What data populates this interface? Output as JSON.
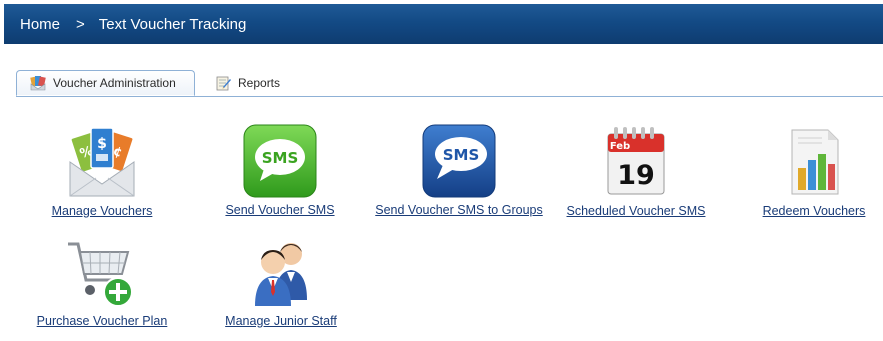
{
  "breadcrumb": {
    "home": "Home",
    "separator": ">",
    "current": "Text Voucher Tracking"
  },
  "tabs": [
    {
      "label": "Voucher Administration",
      "icon": "voucher-admin-icon",
      "active": true
    },
    {
      "label": "Reports",
      "icon": "reports-icon",
      "active": false
    }
  ],
  "tiles": [
    {
      "label": "Manage Vouchers",
      "icon": "vouchers-envelope-icon"
    },
    {
      "label": "Send Voucher SMS",
      "icon": "sms-green-icon",
      "icon_text": "SMS"
    },
    {
      "label": "Send Voucher SMS to Groups",
      "icon": "sms-blue-icon",
      "icon_text": "SMS"
    },
    {
      "label": "Scheduled Voucher SMS",
      "icon": "calendar-icon",
      "month": "Feb",
      "day": "19"
    },
    {
      "label": "Redeem Vouchers",
      "icon": "bar-chart-report-icon"
    },
    {
      "label": "Purchase Voucher Plan",
      "icon": "shopping-cart-add-icon"
    },
    {
      "label": "Manage Junior Staff",
      "icon": "staff-people-icon"
    }
  ],
  "colors": {
    "header_top": "#1f5a97",
    "header_bottom": "#0e3c70",
    "link": "#1a3c78",
    "sms_green": "#4bb32a",
    "sms_blue": "#1f56a8"
  }
}
